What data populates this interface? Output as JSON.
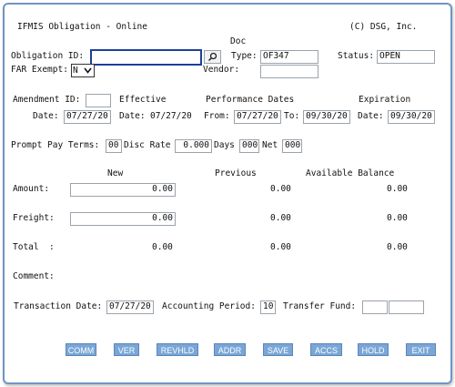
{
  "header": {
    "title": "IFMIS Obligation - Online",
    "copyright": "(C) DSG, Inc."
  },
  "obligation": {
    "id_label": "Obligation ID:",
    "id_value": "",
    "doc_label": "Doc",
    "type_label": "Type:",
    "type_value": "OF347",
    "status_label": "Status:",
    "status_value": "OPEN",
    "far_label": "FAR Exempt:",
    "far_value": "N",
    "vendor_label": "Vendor:",
    "vendor_value": ""
  },
  "amendment": {
    "id_label": "Amendment ID:",
    "id_value": "",
    "date_label": "Date:",
    "date_value": "07/27/20"
  },
  "effective": {
    "heading": "Effective",
    "date_label": "Date:",
    "date_value": "07/27/20"
  },
  "performance": {
    "heading": "Performance Dates",
    "from_label": "From:",
    "from_value": "07/27/20",
    "to_label": "To:",
    "to_value": "09/30/20"
  },
  "expiration": {
    "heading": "Expiration",
    "date_label": "Date:",
    "date_value": "09/30/20"
  },
  "prompt_pay": {
    "terms_label": "Prompt Pay Terms:",
    "terms_value": "00",
    "disc_label": "Disc Rate",
    "disc_value": "0.000",
    "days_label": "Days",
    "days_value": "000",
    "net_label": "Net",
    "net_value": "000"
  },
  "amounts": {
    "col_new": "New",
    "col_previous": "Previous",
    "col_available": "Available Balance",
    "amount_label": "Amount:",
    "amount_new": "0.00",
    "amount_prev": "0.00",
    "amount_avail": "0.00",
    "freight_label": "Freight:",
    "freight_new": "0.00",
    "freight_prev": "0.00",
    "freight_avail": "0.00",
    "total_label": "Total  :",
    "total_new": "0.00",
    "total_prev": "0.00",
    "total_avail": "0.00"
  },
  "comment_label": "Comment:",
  "footer": {
    "trans_date_label": "Transaction Date:",
    "trans_date_value": "07/27/20",
    "period_label": "Accounting Period:",
    "period_value": "10",
    "transfer_label": "Transfer Fund:",
    "transfer_value1": "",
    "transfer_value2": ""
  },
  "buttons": [
    "COMM",
    "VER",
    "REVHLD",
    "ADDR",
    "SAVE",
    "ACCS",
    "HOLD",
    "EXIT"
  ],
  "icons": {
    "search": "search-icon",
    "dropdown": "chevron-down-icon"
  }
}
